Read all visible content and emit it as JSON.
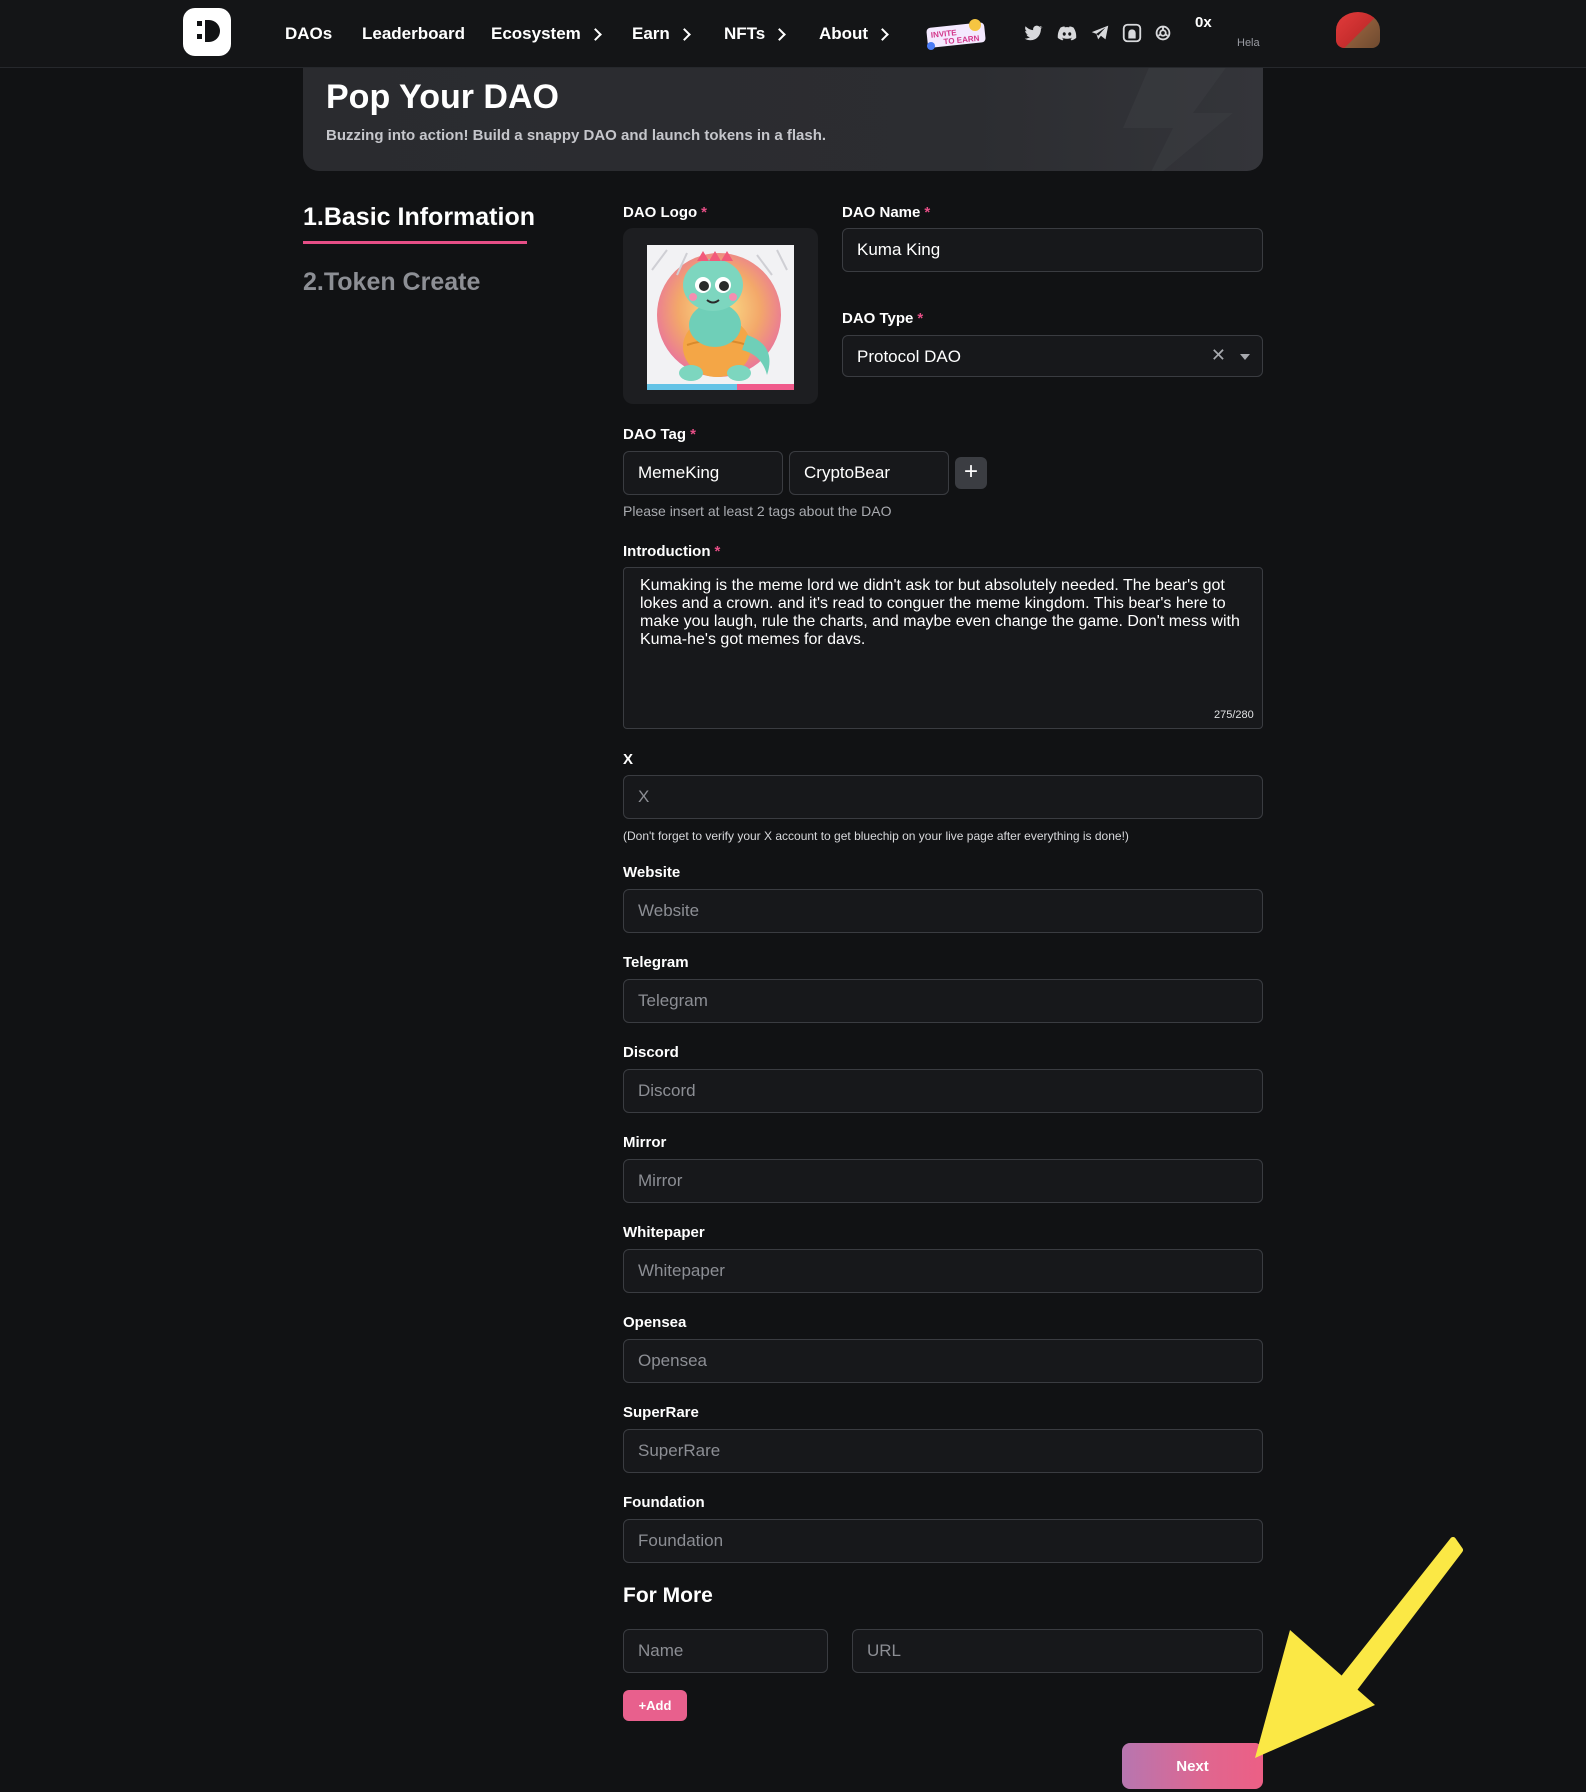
{
  "nav": {
    "items": [
      {
        "label": "DAOs",
        "has_chevron": false
      },
      {
        "label": "Leaderboard",
        "has_chevron": false
      },
      {
        "label": "Ecosystem",
        "has_chevron": true
      },
      {
        "label": "Earn",
        "has_chevron": true
      },
      {
        "label": "NFTs",
        "has_chevron": true
      },
      {
        "label": "About",
        "has_chevron": true
      }
    ],
    "invite_badge": "INVITE TO EARN",
    "socials": [
      "twitter-icon",
      "discord-icon",
      "telegram-icon",
      "mirror-icon",
      "openai-icon"
    ],
    "wallet_address": "0x",
    "wallet_sub": "Hela"
  },
  "banner": {
    "title": "Pop Your DAO",
    "subtitle": "Buzzing into action! Build a snappy DAO and launch tokens in a flash."
  },
  "steps": [
    {
      "label": "1.Basic Information",
      "active": true
    },
    {
      "label": "2.Token Create",
      "active": false
    }
  ],
  "form": {
    "dao_logo_label": "DAO Logo",
    "dao_name_label": "DAO Name",
    "dao_name_value": "Kuma King",
    "dao_type_label": "DAO Type",
    "dao_type_value": "Protocol DAO",
    "dao_tag_label": "DAO Tag",
    "tags": [
      "MemeKing",
      "CryptoBear"
    ],
    "tag_hint": "Please insert at least 2 tags about the DAO",
    "introduction_label": "Introduction",
    "introduction_value": "Kumaking is the meme lord we didn't ask tor but absolutely needed. The bear's got lokes and a crown. and it's read to conguer the meme kingdom. This bear's here to make you laugh, rule the charts, and maybe even change the game. Don't mess with Kuma-he's got memes for davs.",
    "introduction_counter": "275/280",
    "x_label": "X",
    "x_placeholder": "X",
    "x_hint": "(Don't forget to verify your X account to get bluechip on your live page after everything is done!)",
    "links": [
      {
        "label": "Website",
        "placeholder": "Website"
      },
      {
        "label": "Telegram",
        "placeholder": "Telegram"
      },
      {
        "label": "Discord",
        "placeholder": "Discord"
      },
      {
        "label": "Mirror",
        "placeholder": "Mirror"
      },
      {
        "label": "Whitepaper",
        "placeholder": "Whitepaper"
      },
      {
        "label": "Opensea",
        "placeholder": "Opensea"
      },
      {
        "label": "SuperRare",
        "placeholder": "SuperRare"
      },
      {
        "label": "Foundation",
        "placeholder": "Foundation"
      }
    ],
    "for_more_title": "For More",
    "for_more_name_placeholder": "Name",
    "for_more_url_placeholder": "URL",
    "add_button": "+Add",
    "next_button": "Next"
  },
  "colors": {
    "accent": "#e64e86",
    "background": "#111214",
    "field_border": "#3a3c41",
    "annotation_arrow": "#fbe845"
  }
}
